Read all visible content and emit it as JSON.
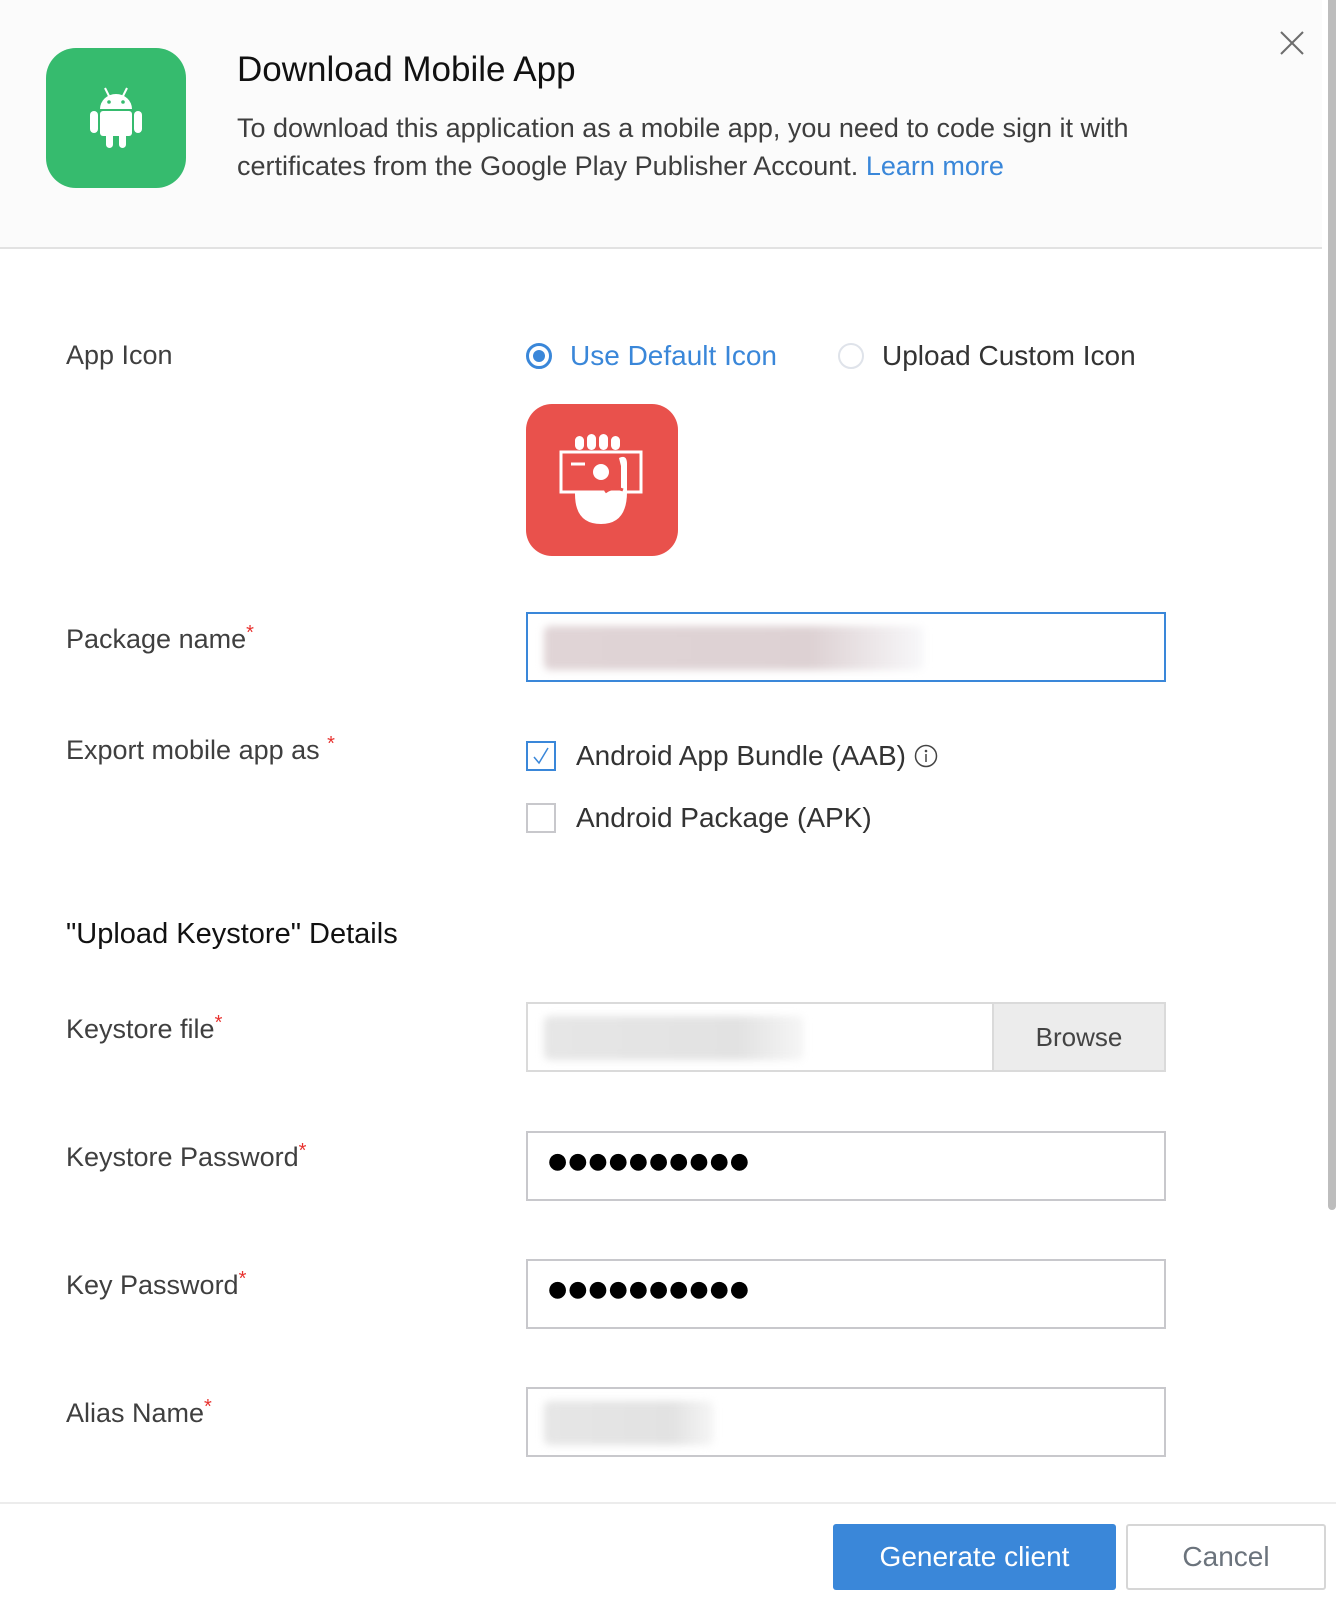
{
  "dialog": {
    "title": "Download Mobile App",
    "description": "To download this application as a mobile app, you need to code sign it with certificates from the Google Play Publisher Account.",
    "learn_more": "Learn more",
    "platform_icon": "android-icon",
    "close_icon": "close-icon"
  },
  "app_icon": {
    "label": "App Icon",
    "options": [
      {
        "label": "Use Default Icon",
        "selected": true
      },
      {
        "label": "Upload Custom Icon",
        "selected": false
      }
    ],
    "preview_icon": "hand-holding-money-icon"
  },
  "package_name": {
    "label": "Package name",
    "required_mark": "*",
    "value_redacted": true
  },
  "export": {
    "label": "Export mobile app as",
    "required_mark": "*",
    "options": [
      {
        "label": "Android App Bundle (AAB)",
        "checked": true,
        "info_icon": "info-icon"
      },
      {
        "label": "Android Package (APK)",
        "checked": false
      }
    ]
  },
  "keystore": {
    "section_title": "\"Upload Keystore\" Details",
    "file": {
      "label": "Keystore file",
      "required_mark": "*",
      "browse_label": "Browse",
      "value_redacted": true
    },
    "keystore_password": {
      "label": "Keystore Password",
      "required_mark": "*",
      "masked_value": "●●●●●●●●●●"
    },
    "key_password": {
      "label": "Key Password",
      "required_mark": "*",
      "masked_value": "●●●●●●●●●●"
    },
    "alias_name": {
      "label": "Alias Name",
      "required_mark": "*",
      "value_redacted": true
    }
  },
  "footer": {
    "primary_label": "Generate client",
    "cancel_label": "Cancel"
  },
  "colors": {
    "accent": "#3a87d9",
    "android_green": "#36bb6e",
    "app_icon_red": "#e9514c",
    "required": "#e8322f"
  }
}
